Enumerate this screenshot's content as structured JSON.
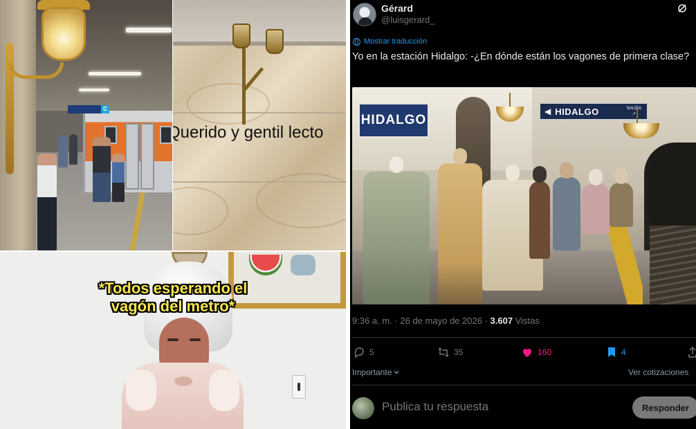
{
  "collage": {
    "panel_top_right_caption": "Querido y gentil lecto",
    "panel_bottom_caption_line1": "*Todos esperando el",
    "panel_bottom_caption_line2": "vagón del metro*",
    "subway_sign_letter": "C"
  },
  "tweet": {
    "display_name": "Gérard",
    "handle": "@luisgerard_",
    "translate_label": "Mostrar traducción",
    "text": "Yo en la estación Hidalgo: -¿En dónde están los vagones de primera clase?",
    "photo": {
      "sign_big": "HIDALGO",
      "sign_small": "HIDALGO",
      "sign_small_exit": "SALIDA",
      "sign_small_exit_arrow": "↗"
    },
    "time": "9:36 a. m.",
    "date": "26 de mayo de 2026",
    "views_count": "3.607",
    "views_label": "Vistas",
    "separator": "·",
    "actions": {
      "replies": "5",
      "reposts": "35",
      "likes": "160",
      "bookmarks": "4"
    },
    "sort_label": "Importante",
    "quotes_link": "Ver cotizaciones",
    "reply_placeholder": "Publica tu respuesta",
    "reply_button": "Responder"
  },
  "colors": {
    "background": "#000000",
    "text_primary": "#e7e9ea",
    "text_secondary": "#71767b",
    "link_blue": "#1d9bf0",
    "like_pink": "#f91880",
    "caption_yellow": "#f7e74b"
  },
  "icons": [
    "grok-icon",
    "globe-icon",
    "reply-icon",
    "repost-icon",
    "heart-icon",
    "bookmark-icon",
    "share-icon",
    "chevron-down-icon"
  ]
}
